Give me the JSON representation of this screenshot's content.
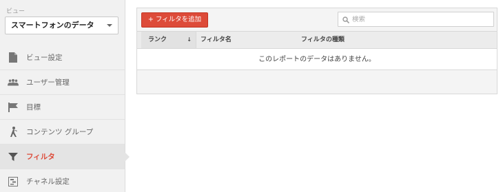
{
  "sidebar": {
    "view_label": "ビュー",
    "view_select": "スマートフォンのデータ",
    "items": [
      {
        "label": "ビュー設定",
        "icon": "document-icon"
      },
      {
        "label": "ユーザー管理",
        "icon": "users-icon"
      },
      {
        "label": "目標",
        "icon": "flag-icon"
      },
      {
        "label": "コンテンツ グループ",
        "icon": "person-walk-icon"
      },
      {
        "label": "フィルタ",
        "icon": "filter-icon",
        "active": true
      },
      {
        "label": "チャネル設定",
        "icon": "channel-icon"
      }
    ]
  },
  "toolbar": {
    "add_filter_label": "+ フィルタを追加",
    "search_placeholder": "検索"
  },
  "table": {
    "columns": [
      "ランク",
      "フィルタ名",
      "フィルタの種類"
    ],
    "empty_message": "このレポートのデータはありません。"
  },
  "colors": {
    "accent": "#dd4b39",
    "sidebar_bg": "#f1f1f1"
  }
}
